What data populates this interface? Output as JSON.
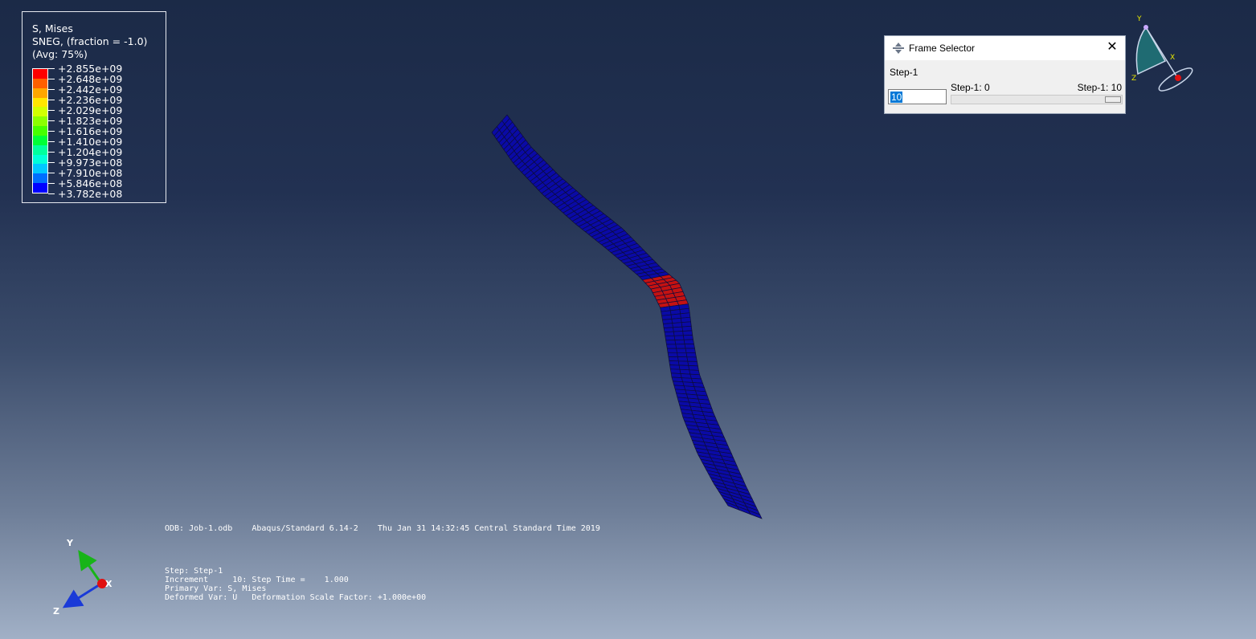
{
  "legend": {
    "title": "S, Mises",
    "subtitle": "SNEG, (fraction = -1.0)",
    "average": "(Avg: 75%)",
    "values": [
      "+2.855e+09",
      "+2.648e+09",
      "+2.442e+09",
      "+2.236e+09",
      "+2.029e+09",
      "+1.823e+09",
      "+1.616e+09",
      "+1.410e+09",
      "+1.204e+09",
      "+9.973e+08",
      "+7.910e+08",
      "+5.846e+08",
      "+3.782e+08"
    ],
    "colors": [
      "#ff0000",
      "#ff5f00",
      "#ffa600",
      "#ffe600",
      "#d2ff00",
      "#8cff00",
      "#46ff00",
      "#00ff37",
      "#00ff9e",
      "#00ffd9",
      "#00c8ff",
      "#006eff",
      "#0000ff"
    ]
  },
  "frame_selector": {
    "title": "Frame Selector",
    "step_label": "Step-1",
    "range_min": "Step-1: 0",
    "range_max": "Step-1: 10",
    "frame_value": "10",
    "slider_fraction": 1.0,
    "icon": "frame-selector-icon"
  },
  "info": {
    "odb_line": "ODB: Job-1.odb    Abaqus/Standard 6.14-2    Thu Jan 31 14:32:45 Central Standard Time 2019",
    "step_line": "Step: Step-1",
    "increment_line": "Increment     10: Step Time =    1.000",
    "primary_line": "Primary Var: S, Mises",
    "deformed_line": "Deformed Var: U   Deformation Scale Factor: +1.000e+00"
  },
  "triad": {
    "y": "Y",
    "x": "X",
    "z": "Z"
  },
  "view_cube": {
    "y": "Y",
    "x": "X",
    "z": "Z"
  },
  "model": {
    "low_color": "#0a0aa6",
    "high_color": "#c41212",
    "mesh_color": "#0d0d3a"
  },
  "colors": {
    "highlight": "#0078d7",
    "triad_y": "#18b418",
    "triad_z": "#1a3ad8",
    "triad_x_dot": "#e01010"
  }
}
